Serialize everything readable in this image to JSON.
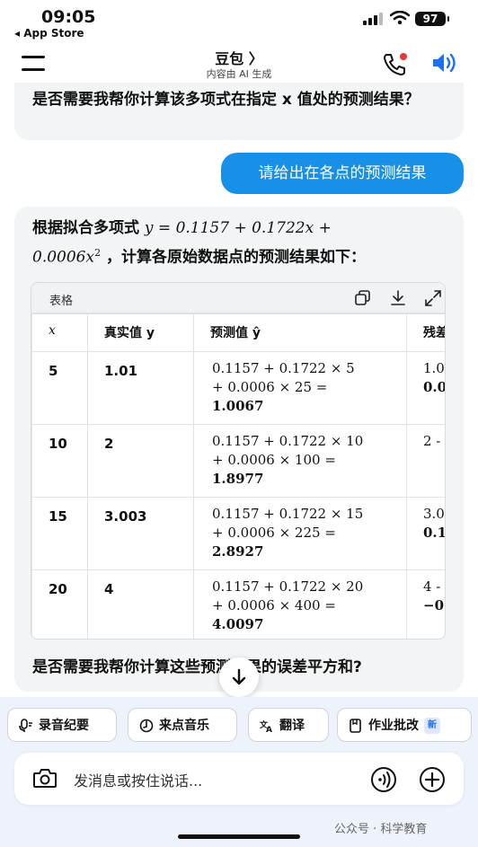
{
  "status_bar": {
    "time": "09:05",
    "back_app": "◂ App Store",
    "battery": "97"
  },
  "nav": {
    "title": "豆包 〉",
    "subtitle": "内容由 AI 生成"
  },
  "chat": {
    "ai_previous": "是否需要我帮你计算该多项式在指定 x 值处的预测结果？",
    "user_message": "请给出在各点的预测结果",
    "ai_intro_prefix": "根据拟合多项式",
    "ai_intro_formula": "y = 0.1157 + 0.1722x +",
    "ai_intro_formula2": "0.0006x",
    "ai_intro_suffix": "，计算各原始数据点的预测结果如下：",
    "table": {
      "label": "表格",
      "headers": [
        "x",
        "真实值 y",
        "预测值 ŷ",
        "残差"
      ],
      "rows": [
        {
          "x": "5",
          "y": "1.01",
          "calc1": "0.1157 + 0.1722 × 5",
          "calc2": "+ 0.0006 × 25 =",
          "pred": "1.0067",
          "r1": "1.0",
          "r2": "0.0"
        },
        {
          "x": "10",
          "y": "2",
          "calc1": "0.1157 + 0.1722 × 10",
          "calc2": "+ 0.0006 × 100 =",
          "pred": "1.8977",
          "r1": "2 -",
          "r2": ""
        },
        {
          "x": "15",
          "y": "3.003",
          "calc1": "0.1157 + 0.1722 × 15",
          "calc2": "+ 0.0006 × 225 =",
          "pred": "2.8927",
          "r1": "3.0",
          "r2": "0.1"
        },
        {
          "x": "20",
          "y": "4",
          "calc1": "0.1157 + 0.1722 × 20",
          "calc2": "+ 0.0006 × 400 =",
          "pred": "4.0097",
          "r1": "4 -",
          "r2": "−0"
        }
      ]
    },
    "ai_outro": "是否需要我帮你计算这些预测结果的误差平方和?"
  },
  "chips": [
    {
      "label": "录音纪要",
      "icon": "mic-icon"
    },
    {
      "label": "来点音乐",
      "icon": "music-icon"
    },
    {
      "label": "翻译",
      "icon": "translate-icon"
    },
    {
      "label": "作业批改",
      "icon": "homework-icon",
      "badge": "新"
    }
  ],
  "input": {
    "placeholder": "发消息或按住说话..."
  },
  "watermark": "公众号 · 科学教育",
  "colors": {
    "accent": "#1990e8",
    "record_dot": "#e53935",
    "speaker": "#1d6ff2"
  }
}
